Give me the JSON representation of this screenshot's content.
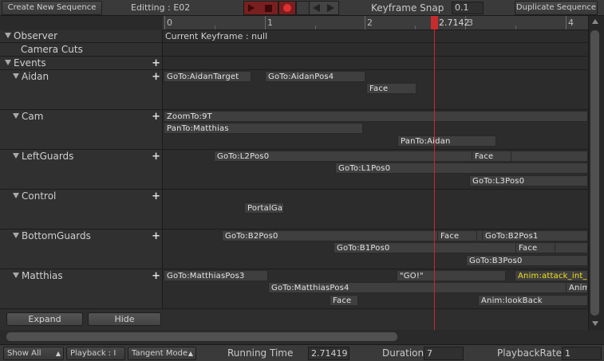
{
  "toolbar": {
    "create_label": "Create New Sequence",
    "editing_label": "Editting : E02",
    "snap_label": "Keyframe Snap",
    "snap_value": "0.1",
    "duplicate_label": "Duplicate Sequence"
  },
  "ruler": {
    "ticks": [
      "0",
      "1",
      "2",
      "3",
      "4"
    ],
    "playhead_value": "2.7142"
  },
  "current_keyframe": "Current Keyframe : null",
  "tree": {
    "observer": "Observer",
    "camera_cuts": "Camera Cuts",
    "events": "Events",
    "aidan": "Aidan",
    "cam": "Cam",
    "leftguards": "LeftGuards",
    "control": "Control",
    "bottomguards": "BottomGuards",
    "matthias": "Matthias"
  },
  "clips": {
    "aidan_1": "GoTo:AidanTarget",
    "aidan_2": "GoTo:AidanPos4",
    "aidan_3": "Face",
    "cam_1": "ZoomTo:9T",
    "cam_2": "PanTo:Matthias",
    "cam_3": "PanTo:Aidan",
    "lg_1": "GoTo:L2Pos0",
    "lg_2": "Face",
    "lg_3": "GoTo:L1Pos0",
    "lg_4": "GoTo:L3Pos0",
    "ctrl_1": "PortalGate.Open",
    "bg_1": "GoTo:B2Pos0",
    "bg_2": "Face",
    "bg_3": "GoTo:B2Pos1",
    "bg_4": "GoTo:B1Pos0",
    "bg_5": "Face",
    "bg_6": "GoTo:B3Pos0",
    "m_1": "GoTo:MatthiasPos3",
    "m_2": "\"GO!\"",
    "m_3": "Anim:attack_int_",
    "m_4": "GoTo:MatthiasPos4",
    "m_5": "Anim",
    "m_6": "Face",
    "m_7": "Anim:lookBack"
  },
  "buttons": {
    "expand": "Expand",
    "hide": "Hide"
  },
  "bottombar": {
    "show_all": "Show All",
    "playback": "Playback : I",
    "tangent": "Tangent Mode",
    "running_label": "Running Time",
    "running_value": "2.71419",
    "duration_label": "Duration",
    "duration_value": "7",
    "rate_label": "PlaybackRate",
    "rate_value": "1"
  },
  "colors": {
    "playhead": "#d32525",
    "highlight_clip_text": "#f2e01c"
  }
}
